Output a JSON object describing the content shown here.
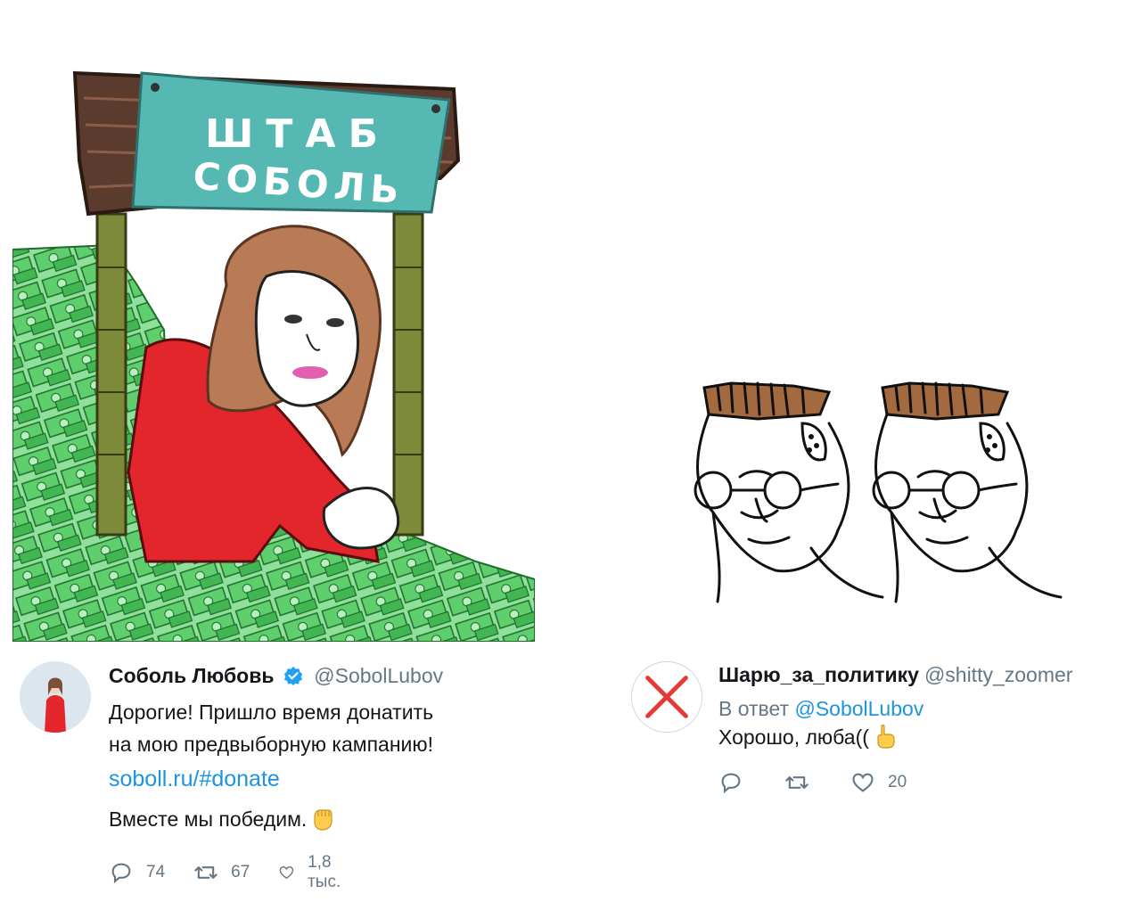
{
  "meme_left": {
    "sign_line1": "ШТАБ",
    "sign_line2": "СОБОЛЬ"
  },
  "tweet_left": {
    "display_name": "Соболь Любовь",
    "handle": "@SobolLubov",
    "text_line1": "Дорогие! Пришло время донатить",
    "text_line2": "на мою предвыборную кампанию!",
    "link": "soboll.ru/#donate",
    "closing": "Вместе мы победим.",
    "closing_emoji": "raised-fist-emoji",
    "reply_count": "74",
    "retweet_count": "67",
    "like_count": "1,8 тыс."
  },
  "tweet_right": {
    "display_name": "Шарю_за_политику",
    "handle": "@shitty_zoomer",
    "reply_prefix": "В ответ",
    "reply_to": "@SobolLubov",
    "text": "Хорошо, люба((",
    "text_emoji": "pointing-up-emoji",
    "like_count": "20"
  },
  "colors": {
    "link": "#1b95e0",
    "muted": "#657786",
    "text": "#14171a",
    "verified": "#1da1f2",
    "sign_banner": "#56b8b3",
    "money_green": "#4cbf5a",
    "sweater_red": "#e3262c",
    "cross_red": "#e53935"
  }
}
